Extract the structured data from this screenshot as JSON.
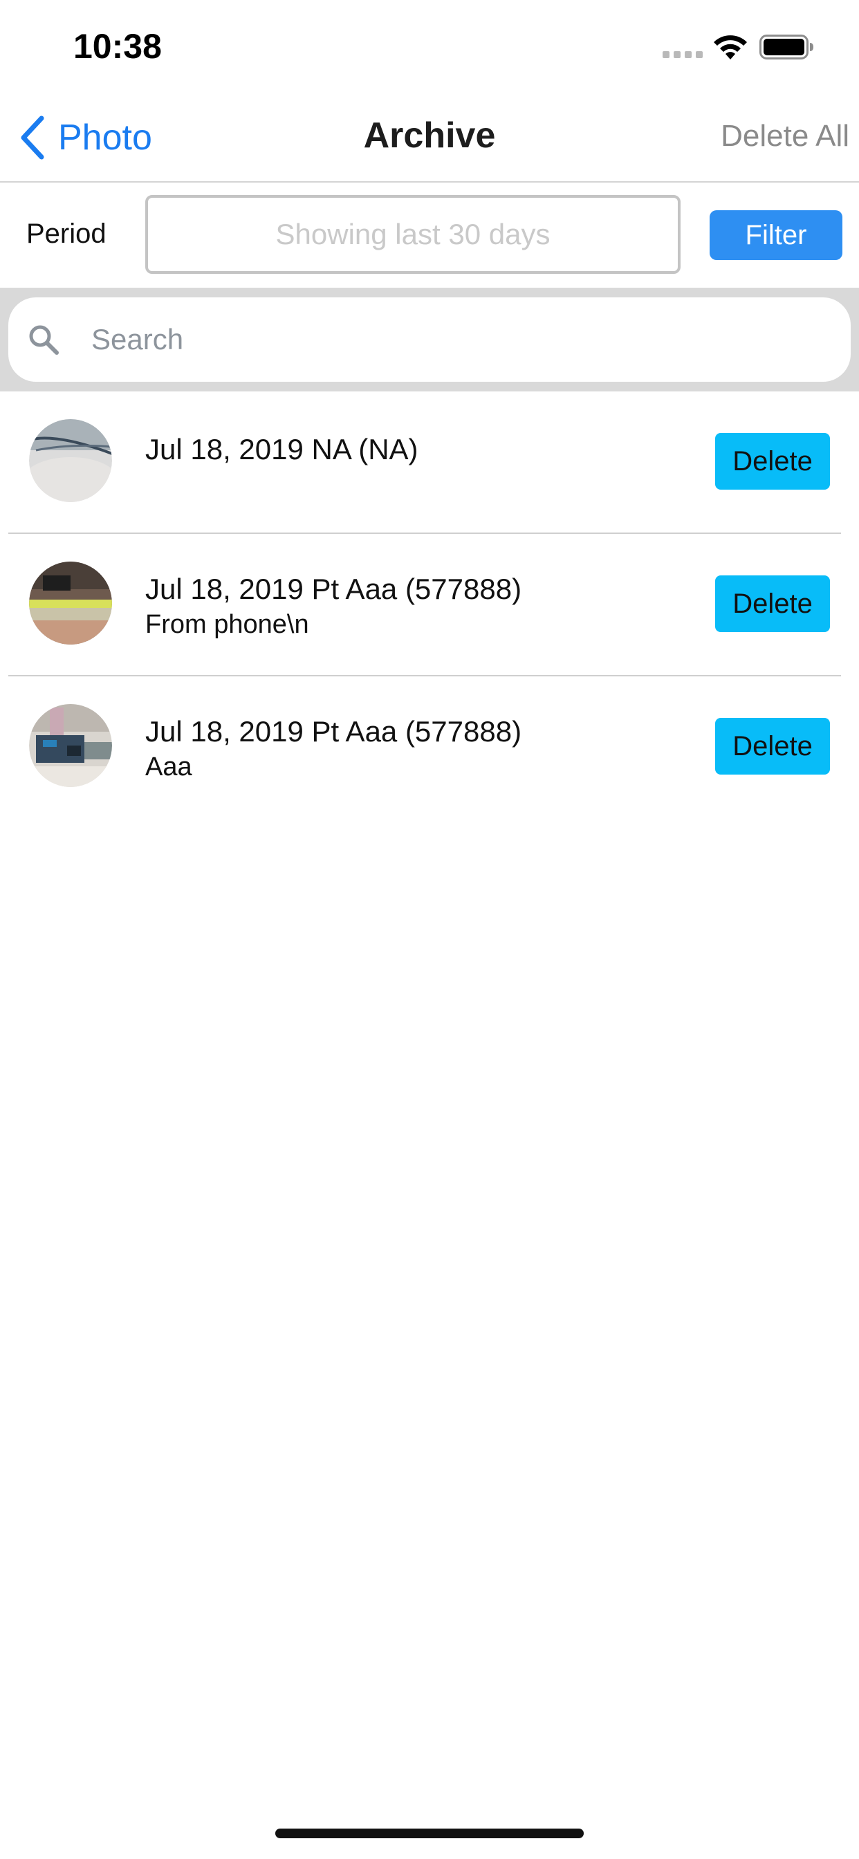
{
  "status_bar": {
    "time": "10:38",
    "icons": [
      "signal-dots-icon",
      "wifi-icon",
      "battery-icon"
    ]
  },
  "nav": {
    "back_label": "Photo",
    "title": "Archive",
    "delete_all_label": "Delete All"
  },
  "filter": {
    "period_label": "Period",
    "period_placeholder": "Showing last 30 days",
    "filter_label": "Filter"
  },
  "search": {
    "placeholder": "Search"
  },
  "items": [
    {
      "title": "Jul 18, 2019 NA (NA)",
      "subtitle": "",
      "delete_label": "Delete"
    },
    {
      "title": "Jul 18, 2019 Pt Aaa (577888)",
      "subtitle": "From phone\\n",
      "delete_label": "Delete"
    },
    {
      "title": "Jul 18, 2019 Pt Aaa (577888)",
      "subtitle": "Aaa",
      "delete_label": "Delete"
    }
  ],
  "colors": {
    "accent_blue": "#1a7cf0",
    "filter_button": "#2e8ff2",
    "delete_button": "#08bcf8",
    "search_background": "#d9d9d9"
  }
}
